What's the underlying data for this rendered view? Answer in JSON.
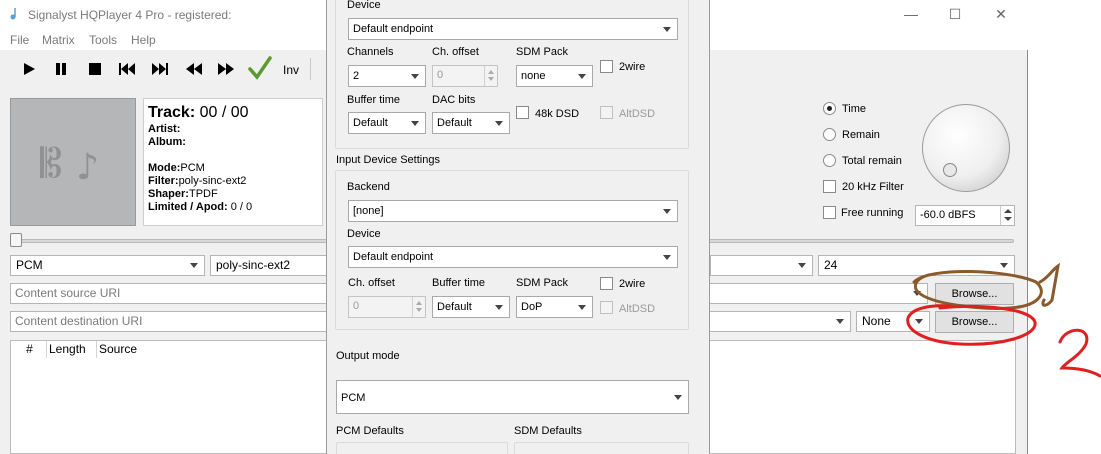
{
  "window": {
    "title": "Signalyst HQPlayer 4 Pro - registered:",
    "minimize_glyph": "—",
    "maximize_glyph": "☐",
    "close_glyph": "✕"
  },
  "menu": {
    "file": "File",
    "matrix": "Matrix",
    "tools": "Tools",
    "help": "Help"
  },
  "toolbar": {
    "inv_label": "Inv",
    "icons": [
      "play-icon",
      "pause-icon",
      "stop-icon",
      "previous-track-icon",
      "next-track-icon",
      "rewind-icon",
      "fast-forward-icon",
      "checkmark-icon"
    ],
    "check_color": "#5a9a2e"
  },
  "track": {
    "track_label": "Track:",
    "track_value": "00 / 00",
    "artist_label": "Artist:",
    "album_label": "Album:",
    "mode_label": "Mode:",
    "mode_value": "PCM",
    "filter_label": "Filter:",
    "filter_value": "poly-sinc-ext2",
    "shaper_label": "Shaper:",
    "shaper_value": "TPDF",
    "limited_label": "Limited / Apod:",
    "limited_value": "0 / 0",
    "art_icon": "music-notes-icon"
  },
  "progress": {
    "fraction": 0.0
  },
  "selectors": {
    "mode": "PCM",
    "filter": "poly-sinc-ext2",
    "rate": "24"
  },
  "uris": {
    "source_placeholder": "Content source URI",
    "destination_placeholder": "Content destination URI",
    "browse_label": "Browse...",
    "none_label": "None"
  },
  "playlist": {
    "columns": [
      "#",
      "Length",
      "Source"
    ]
  },
  "display": {
    "time_label": "Time",
    "remain_label": "Remain",
    "total_remain_label": "Total remain",
    "filter20k_label": "20 kHz Filter",
    "free_running_label": "Free running",
    "volume_value": "-60.0 dBFS",
    "selected": "Time"
  },
  "dialog": {
    "output": {
      "device_label": "Device",
      "device_value": "Default endpoint",
      "channels_label": "Channels",
      "channels_value": "2",
      "ch_offset_label": "Ch. offset",
      "ch_offset_value": "0",
      "sdm_pack_label": "SDM Pack",
      "sdm_pack_value": "none",
      "twowire_label": "2wire",
      "buffer_time_label": "Buffer time",
      "buffer_time_value": "Default",
      "dac_bits_label": "DAC bits",
      "dac_bits_value": "Default",
      "dsd48k_label": "48k DSD",
      "altdsd_label": "AltDSD"
    },
    "input": {
      "section_label": "Input Device Settings",
      "backend_label": "Backend",
      "backend_value": "[none]",
      "device_label": "Device",
      "device_value": "Default endpoint",
      "ch_offset_label": "Ch. offset",
      "ch_offset_value": "0",
      "buffer_time_label": "Buffer time",
      "buffer_time_value": "Default",
      "sdm_pack_label": "SDM Pack",
      "sdm_pack_value": "DoP",
      "twowire_label": "2wire",
      "altdsd_label": "AltDSD"
    },
    "output_mode": {
      "label": "Output mode",
      "value": "PCM",
      "pcm_defaults_label": "PCM Defaults",
      "sdm_defaults_label": "SDM Defaults"
    }
  },
  "annotations": {
    "color_1": "#8a5a2b",
    "color_2": "#e02020"
  }
}
